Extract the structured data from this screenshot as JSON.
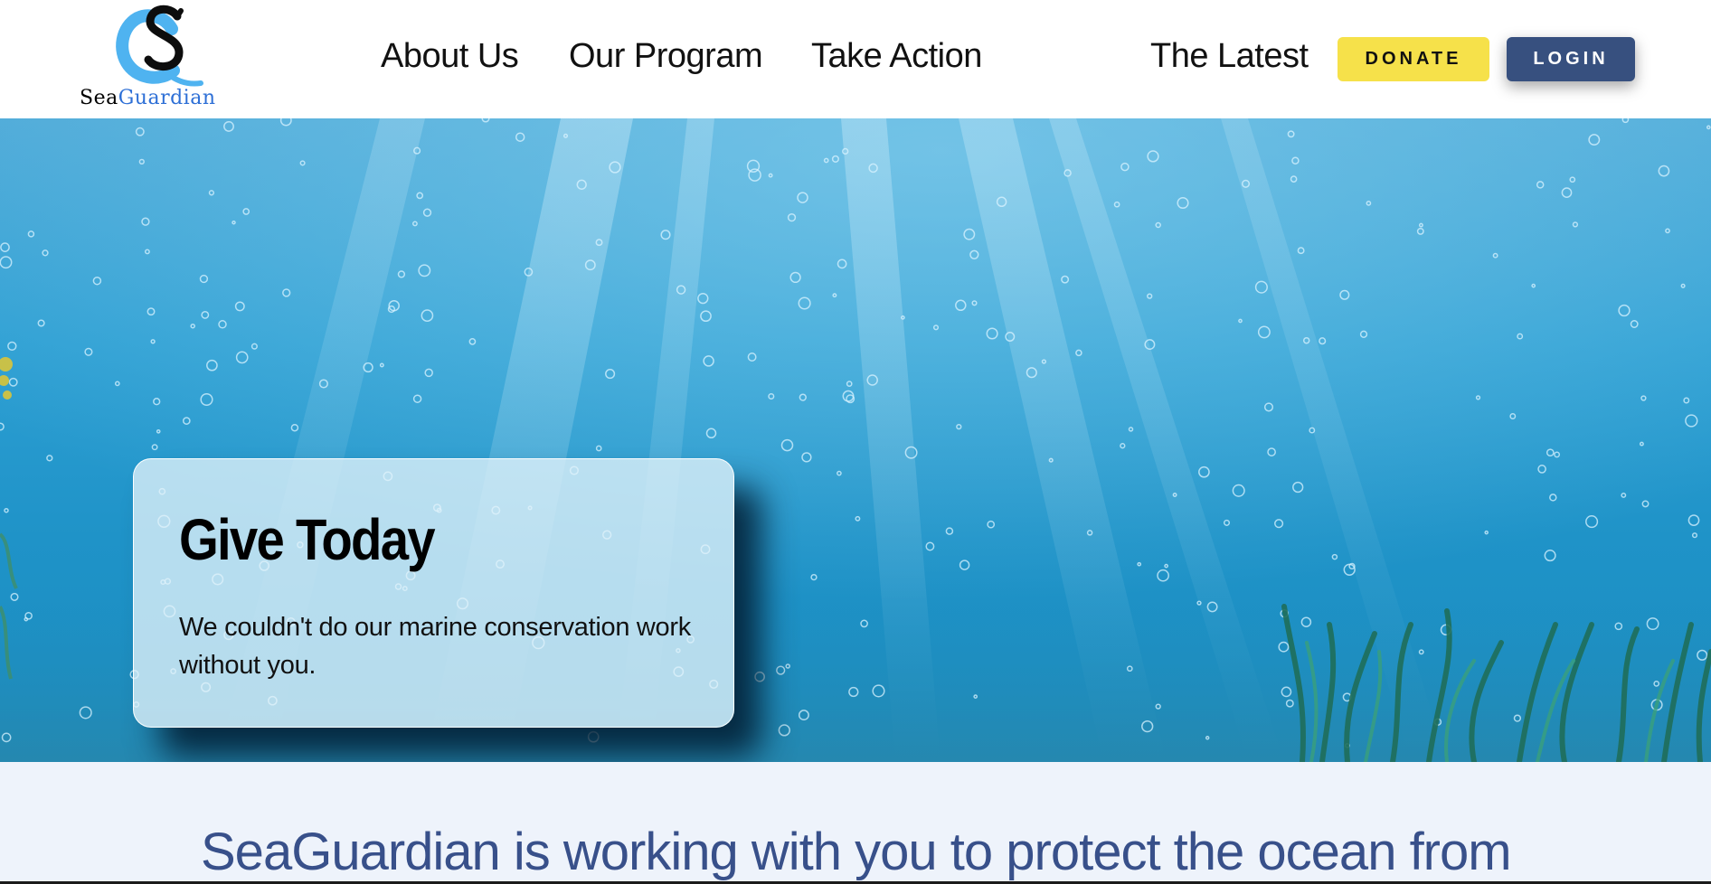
{
  "brand": {
    "name_part1": "Sea",
    "name_part2": "Guardian",
    "logo_icon": "sg-monogram-logo",
    "colors": {
      "black": "#000000",
      "blue": "#2d6fd6",
      "light_blue": "#4fb3f0"
    }
  },
  "nav": {
    "items": [
      {
        "label": "About Us"
      },
      {
        "label": "Our Program"
      },
      {
        "label": "Take Action"
      },
      {
        "label": "The Latest"
      }
    ],
    "donate_label": "DONATE",
    "login_label": "LOGIN"
  },
  "hero": {
    "background": "underwater-scene-with-bubbles-light-rays-and-seagrass",
    "card": {
      "title": "Give Today",
      "text": "We couldn't do our marine conservation work without you."
    }
  },
  "mission": {
    "heading": "SeaGuardian is working with you to protect the ocean from"
  },
  "colors": {
    "donate": "#f6e14a",
    "login": "#37507f",
    "mission_text": "#38508a",
    "mission_bg": "#eef3fb"
  }
}
